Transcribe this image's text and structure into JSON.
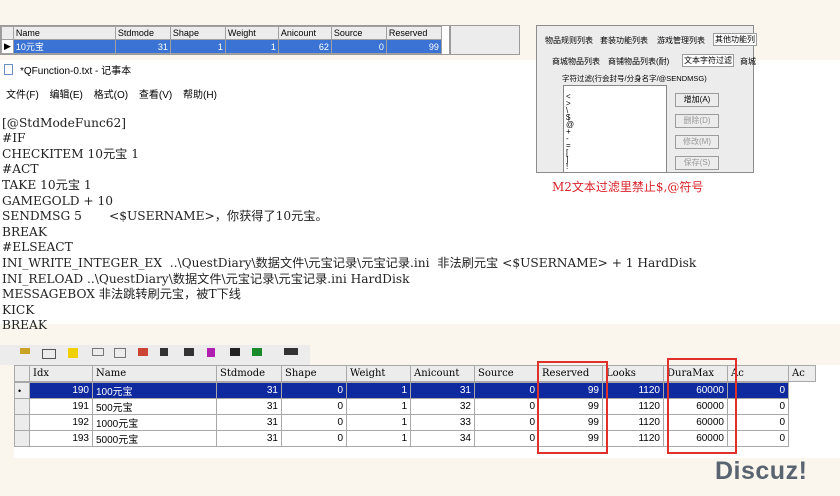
{
  "top_grid": {
    "headers": [
      "Name",
      "Stdmode",
      "Shape",
      "Weight",
      "Anicount",
      "Source",
      "Reserved"
    ],
    "row": [
      "10元宝",
      "31",
      "1",
      "1",
      "62",
      "0",
      "99"
    ]
  },
  "notepad": {
    "title": "*QFunction-0.txt - 记事本",
    "menu": [
      "文件(F)",
      "编辑(E)",
      "格式(O)",
      "查看(V)",
      "帮助(H)"
    ],
    "lines": [
      "[@StdModeFunc62]",
      "#IF",
      "CHECKITEM 10元宝 1",
      "#ACT",
      "TAKE 10元宝 1",
      "GAMEGOLD + 10",
      "SENDMSG 5       <$USERNAME>，你获得了10元宝。",
      "BREAK",
      "#ELSEACT",
      "INI_WRITE_INTEGER_EX  ..\\QuestDiary\\数据文件\\元宝记录\\元宝记录.ini  非法刷元宝 <$USERNAME> + 1 HardDisk",
      "INI_RELOAD ..\\QuestDiary\\数据文件\\元宝记录\\元宝记录.ini HardDisk",
      "MESSAGEBOX 非法跳转刷元宝，被T下线",
      "KICK",
      "BREAK"
    ]
  },
  "dialog": {
    "tabs_row1": [
      "物品规则列表",
      "套装功能列表",
      "游戏管理列表",
      "其他功能列"
    ],
    "tabs_row2": [
      "商城物品列表",
      "商铺物品列表(耐)",
      "文本字符过滤",
      "商城"
    ],
    "group_title": "字符过滤(行会封号/分身名字/@SENDMSG)",
    "list_items": [
      "<",
      ">",
      "\\",
      "$",
      "@",
      "+",
      "-",
      "=",
      "[",
      "]",
      "!"
    ],
    "buttons": [
      "增加(A)",
      "删除(D)",
      "修改(M)",
      "保存(S)"
    ],
    "caption": "M2文本过滤里禁止$,@符号"
  },
  "bottom_grid": {
    "headers": [
      "Idx",
      "Name",
      "Stdmode",
      "Shape",
      "Weight",
      "Anicount",
      "Source",
      "Reserved",
      "Looks",
      "DuraMax",
      "Ac",
      "Ac"
    ],
    "rows": [
      [
        "190",
        "100元宝",
        "31",
        "0",
        "1",
        "31",
        "0",
        "99",
        "1120",
        "60000",
        "0"
      ],
      [
        "191",
        "500元宝",
        "31",
        "0",
        "1",
        "32",
        "0",
        "99",
        "1120",
        "60000",
        "0"
      ],
      [
        "192",
        "1000元宝",
        "31",
        "0",
        "1",
        "33",
        "0",
        "99",
        "1120",
        "60000",
        "0"
      ],
      [
        "193",
        "5000元宝",
        "31",
        "0",
        "1",
        "34",
        "0",
        "99",
        "1120",
        "60000",
        "0"
      ]
    ],
    "selected_marker": "•"
  },
  "watermark": "Discuz!",
  "colors": {
    "highlight": "#e0302a",
    "selection_blue": "#0f2a9e",
    "caption_red": "#d8232a"
  },
  "chart_data": {
    "type": "table",
    "columns": [
      "Idx",
      "Name",
      "Stdmode",
      "Shape",
      "Weight",
      "Anicount",
      "Source",
      "Reserved",
      "Looks",
      "DuraMax",
      "Ac"
    ],
    "rows": [
      [
        190,
        "100元宝",
        31,
        0,
        1,
        31,
        0,
        99,
        1120,
        60000,
        0
      ],
      [
        191,
        "500元宝",
        31,
        0,
        1,
        32,
        0,
        99,
        1120,
        60000,
        0
      ],
      [
        192,
        "1000元宝",
        31,
        0,
        1,
        33,
        0,
        99,
        1120,
        60000,
        0
      ],
      [
        193,
        "5000元宝",
        31,
        0,
        1,
        34,
        0,
        99,
        1120,
        60000,
        0
      ]
    ],
    "highlighted_columns": [
      "Reserved",
      "DuraMax"
    ]
  }
}
